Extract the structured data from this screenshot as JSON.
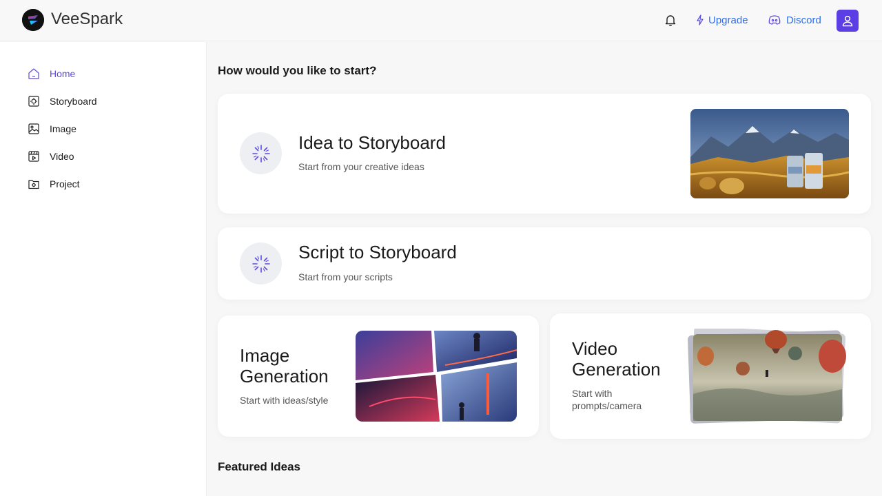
{
  "app": {
    "name": "VeeSpark"
  },
  "header": {
    "upgrade_label": "Upgrade",
    "discord_label": "Discord"
  },
  "sidebar": {
    "items": [
      {
        "label": "Home",
        "icon": "home-icon",
        "active": true
      },
      {
        "label": "Storyboard",
        "icon": "storyboard-icon"
      },
      {
        "label": "Image",
        "icon": "image-icon"
      },
      {
        "label": "Video",
        "icon": "video-icon"
      },
      {
        "label": "Project",
        "icon": "project-icon"
      }
    ]
  },
  "main": {
    "heading": "How would you like to start?",
    "cards": [
      {
        "title": "Idea to Storyboard",
        "subtitle": "Start from your creative ideas"
      },
      {
        "title": "Script to Storyboard",
        "subtitle": "Start from your scripts"
      },
      {
        "title": "Image Generation",
        "subtitle": "Start with ideas/style"
      },
      {
        "title": "Video Generation",
        "subtitle": "Start with prompts/camera"
      }
    ],
    "featured_heading": "Featured Ideas"
  },
  "colors": {
    "accent": "#5a4be0",
    "link": "#2f6fed",
    "avatar_bg": "#5b3fe4"
  }
}
